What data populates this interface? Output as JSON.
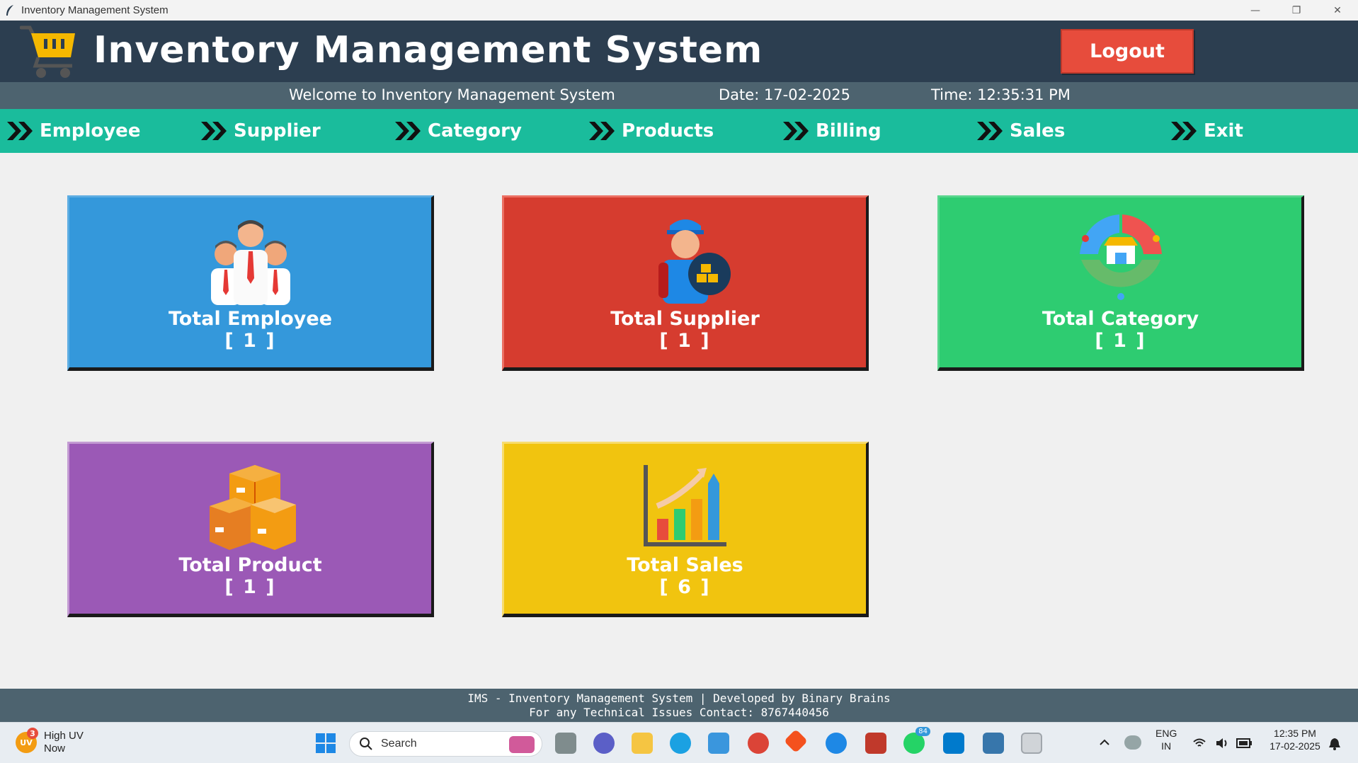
{
  "window": {
    "title": "Inventory Management System",
    "minimize": "—",
    "maximize": "❐",
    "close": "✕"
  },
  "header": {
    "title": "Inventory Management System",
    "logout_label": "Logout"
  },
  "subheader": {
    "welcome": "Welcome to Inventory Management System",
    "date": "Date: 17-02-2025",
    "time": "Time: 12:35:31 PM"
  },
  "nav": {
    "items": [
      {
        "label": "Employee"
      },
      {
        "label": "Supplier"
      },
      {
        "label": "Category"
      },
      {
        "label": "Products"
      },
      {
        "label": "Billing"
      },
      {
        "label": "Sales"
      },
      {
        "label": "Exit"
      }
    ]
  },
  "cards": {
    "employee": {
      "label": "Total Employee",
      "count": "[ 1 ]",
      "color": "#3498db",
      "icon": "employees-icon"
    },
    "supplier": {
      "label": "Total Supplier",
      "count": "[ 1 ]",
      "color": "#d63c2f",
      "icon": "supplier-icon"
    },
    "category": {
      "label": "Total Category",
      "count": "[ 1 ]",
      "color": "#2ecc71",
      "icon": "category-icon"
    },
    "product": {
      "label": "Total Product",
      "count": "[ 1 ]",
      "color": "#9b59b6",
      "icon": "boxes-icon"
    },
    "sales": {
      "label": "Total Sales",
      "count": "[ 6 ]",
      "color": "#f1c40f",
      "icon": "sales-chart-icon"
    }
  },
  "footer": {
    "line1": "IMS - Inventory Management System | Developed by Binary Brains",
    "line2": "For any Technical Issues Contact: 8767440456"
  },
  "taskbar": {
    "weather_badge": "3",
    "weather_title": "High UV",
    "weather_sub": "Now",
    "weather_icon_text": "UV",
    "search_label": "Search",
    "whatsapp_count": "84",
    "lang_top": "ENG",
    "lang_bottom": "IN",
    "clock_time": "12:35 PM",
    "clock_date": "17-02-2025"
  }
}
